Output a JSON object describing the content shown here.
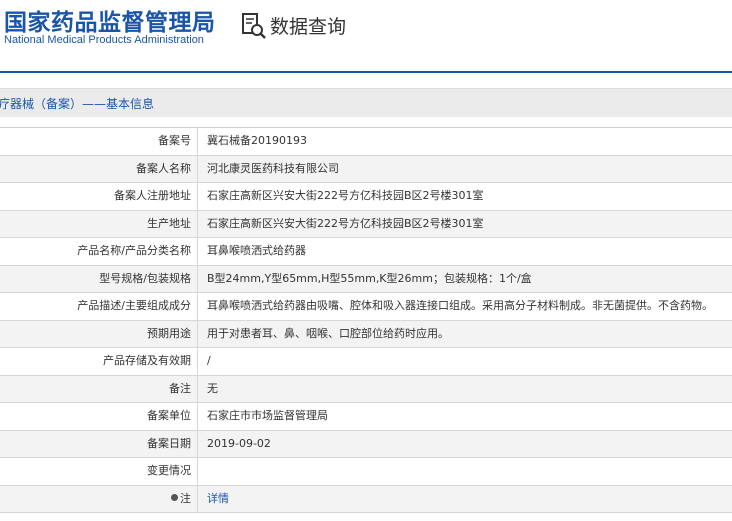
{
  "header": {
    "logo_cn": "国家药品监督管理局",
    "logo_en": "National Medical Products Administration",
    "query_title": "数据查询",
    "query_icon": "search-doc-icon"
  },
  "breadcrumb": "疗器械（备案）——基本信息",
  "rows": [
    {
      "label": "备案号",
      "value": "冀石械备20190193"
    },
    {
      "label": "备案人名称",
      "value": "河北康灵医药科技有限公司"
    },
    {
      "label": "备案人注册地址",
      "value": "石家庄高新区兴安大街222号方亿科技园B区2号楼301室"
    },
    {
      "label": "生产地址",
      "value": "石家庄高新区兴安大街222号方亿科技园B区2号楼301室"
    },
    {
      "label": "产品名称/产品分类名称",
      "value": "耳鼻喉喷洒式给药器"
    },
    {
      "label": "型号规格/包装规格",
      "value": "B型24mm,Y型65mm,H型55mm,K型26mm；包装规格：1个/盒"
    },
    {
      "label": "产品描述/主要组成成分",
      "value": "耳鼻喉喷洒式给药器由吸嘴、腔体和吸入器连接口组成。采用高分子材料制成。非无菌提供。不含药物。"
    },
    {
      "label": "预期用途",
      "value": "用于对患者耳、鼻、咽喉、口腔部位给药时应用。"
    },
    {
      "label": "产品存储及有效期",
      "value": "/"
    },
    {
      "label": "备注",
      "value": "无"
    },
    {
      "label": "备案单位",
      "value": "石家庄市市场监督管理局"
    },
    {
      "label": "备案日期",
      "value": "2019-09-02"
    },
    {
      "label": "变更情况",
      "value": ""
    },
    {
      "label": "注",
      "value": "详情"
    }
  ]
}
